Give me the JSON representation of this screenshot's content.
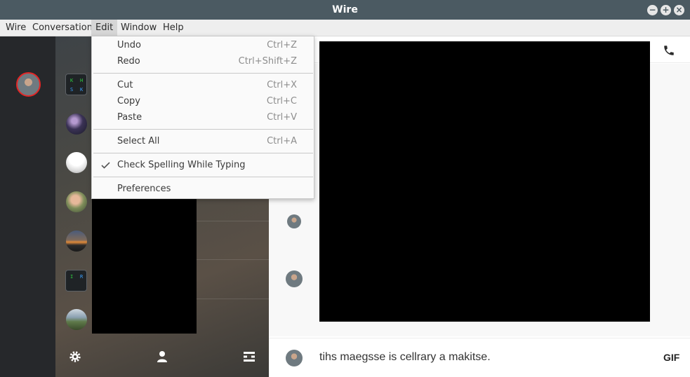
{
  "window": {
    "title": "Wire",
    "controls": {
      "minimize": "−",
      "maximize": "+",
      "close": "×"
    }
  },
  "menubar": {
    "items": [
      {
        "label": "Wire"
      },
      {
        "label": "Conversation"
      },
      {
        "label": "Edit"
      },
      {
        "label": "Window"
      },
      {
        "label": "Help"
      }
    ],
    "active": "Edit"
  },
  "edit_menu": {
    "items": [
      {
        "label": "Undo",
        "shortcut": "Ctrl+Z"
      },
      {
        "label": "Redo",
        "shortcut": "Ctrl+Shift+Z"
      },
      {
        "label": "Cut",
        "shortcut": "Ctrl+X"
      },
      {
        "label": "Copy",
        "shortcut": "Ctrl+C"
      },
      {
        "label": "Paste",
        "shortcut": "Ctrl+V"
      },
      {
        "label": "Select All",
        "shortcut": "Ctrl+A"
      },
      {
        "label": "Check Spelling While Typing",
        "checked": true
      },
      {
        "label": "Preferences"
      }
    ]
  },
  "conversation_list": {
    "group_avatar_1": {
      "letters": [
        "K",
        "H",
        "S",
        "K"
      ]
    },
    "group_avatar_2": {
      "letters": [
        "I",
        "R"
      ]
    }
  },
  "composer": {
    "text": "tihs maegsse is cellrary a makitse.",
    "gif_label": "GIF"
  },
  "colors": {
    "titlebar": "#4b5a62",
    "rail": "#26282b",
    "self_avatar_ring": "#e32626",
    "media": "#000000"
  },
  "icons": [
    "settings-gear-icon",
    "person-icon",
    "archive-icon",
    "phone-icon",
    "checkmark-icon"
  ]
}
